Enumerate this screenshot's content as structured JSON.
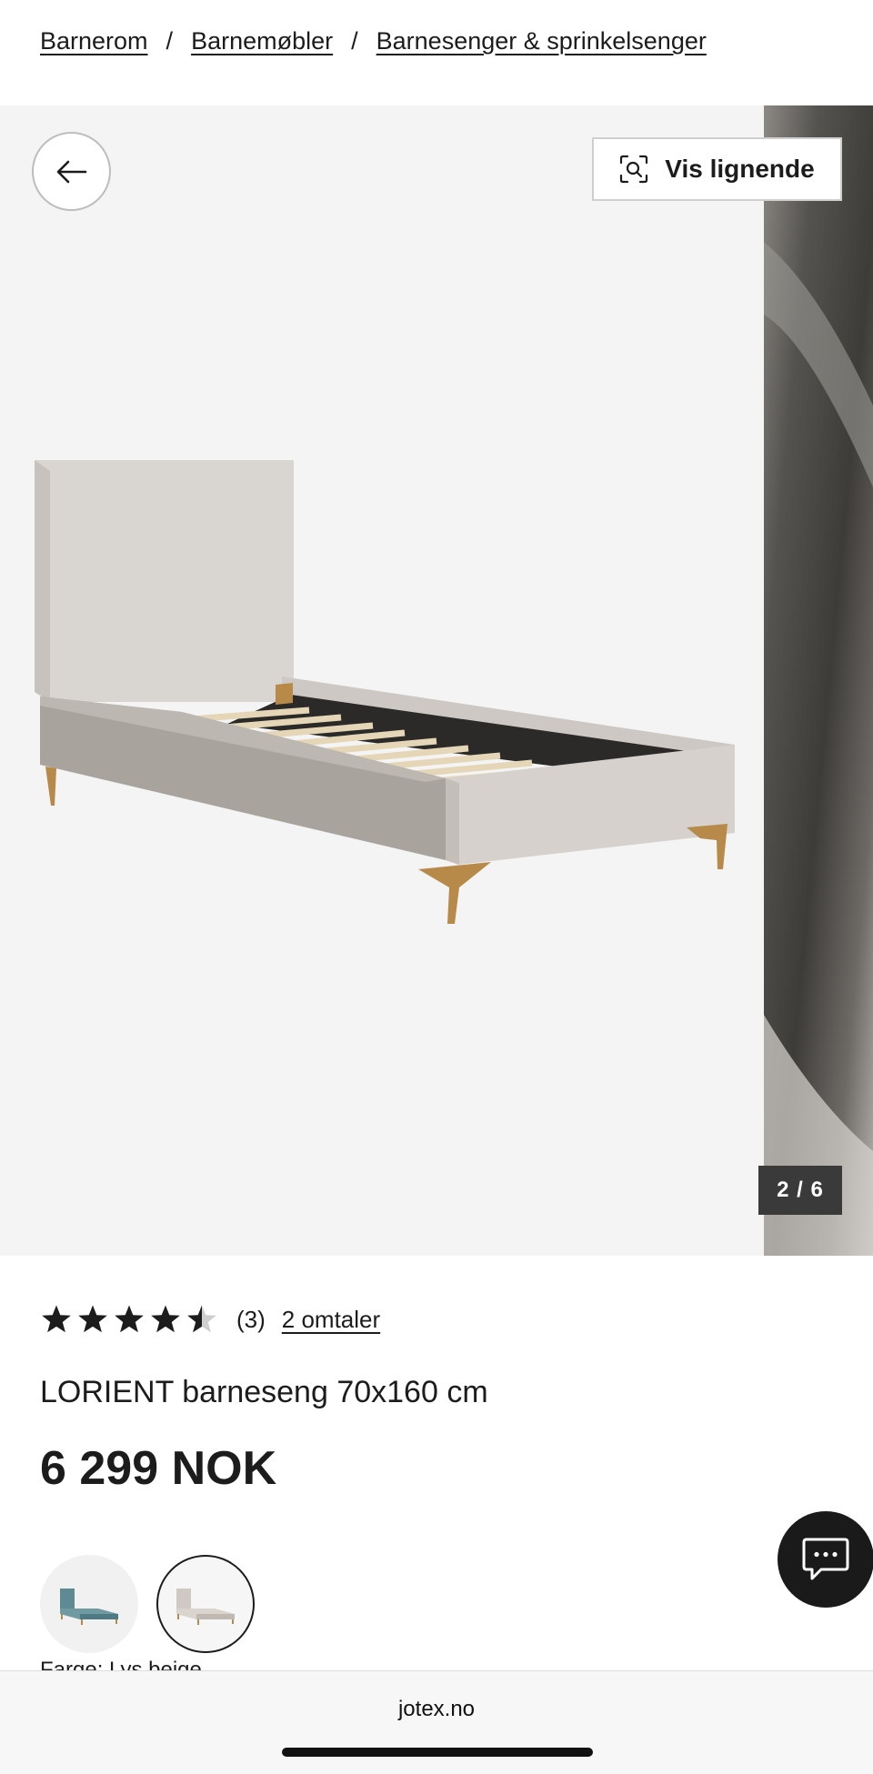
{
  "breadcrumb": {
    "items": [
      "Barnerom",
      "Barnemøbler",
      "Barnesenger & sprinkelsenger"
    ],
    "separator": "/"
  },
  "gallery": {
    "similar_label": "Vis lignende",
    "counter": "2 / 6",
    "current_index": 2,
    "total": 6
  },
  "product": {
    "rating_value": 4.5,
    "rating_count": "(3)",
    "reviews_link": "2 omtaler",
    "title": "LORIENT barneseng 70x160 cm",
    "price": "6 299 NOK",
    "color_label": "Farge: Lys beige",
    "swatches": [
      {
        "name": "blue",
        "color": "#5d8a93",
        "selected": false
      },
      {
        "name": "beige",
        "color": "#cfc9c2",
        "selected": true
      }
    ]
  },
  "browser": {
    "url": "jotex.no"
  },
  "colors": {
    "text": "#1c1c1c",
    "gallery_bg": "#f4f4f5",
    "chat_bg": "#1a1a1a",
    "counter_bg": "#3a3a3a"
  },
  "icons": {
    "back": "arrow-left-icon",
    "similar": "visual-search-icon",
    "chat": "chat-icon",
    "star": "star-icon"
  }
}
